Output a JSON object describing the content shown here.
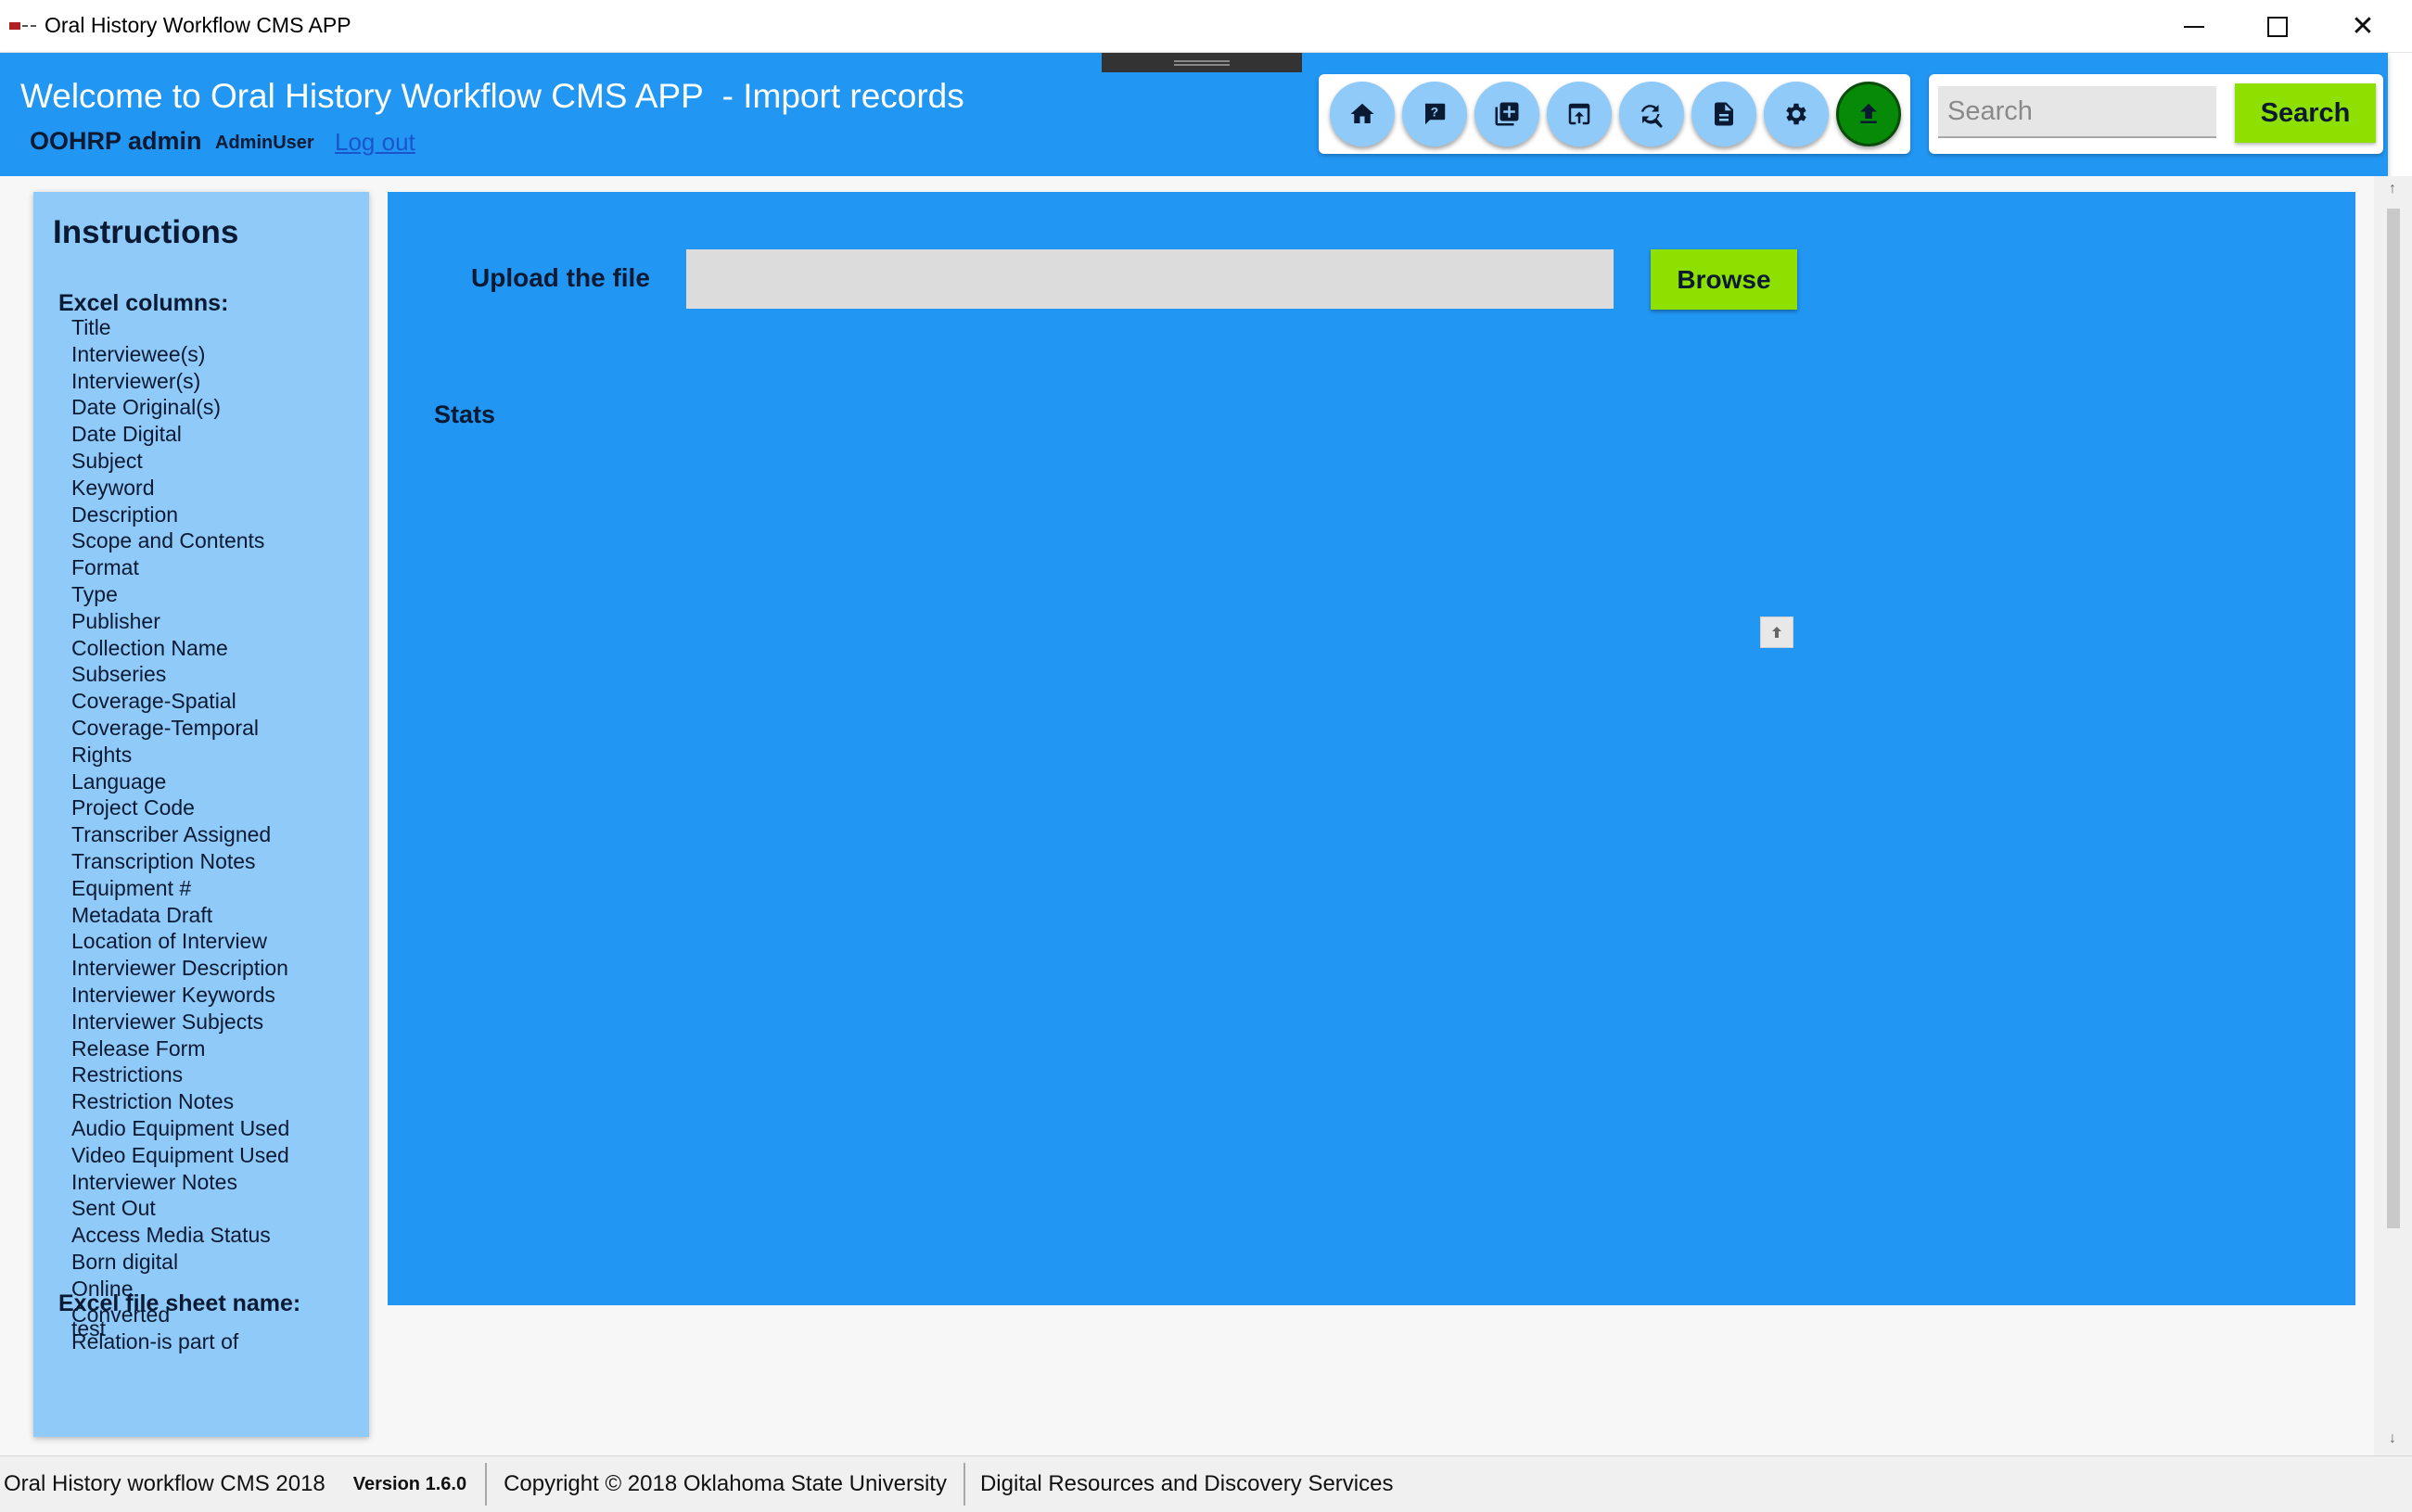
{
  "window": {
    "title": "Oral History Workflow CMS APP",
    "controls": {
      "minimize": "minimize-icon",
      "maximize": "maximize-icon",
      "close": "✕"
    }
  },
  "header": {
    "welcome": "Welcome to Oral History Workflow CMS APP  - Import records",
    "username": "OOHRP admin",
    "role": "AdminUser",
    "logout": "Log out",
    "background": "#2196f3"
  },
  "toolbar": {
    "buttons": [
      {
        "icon": "home-icon",
        "label": "Home",
        "active": false
      },
      {
        "icon": "feedback-icon",
        "label": "Help",
        "active": false
      },
      {
        "icon": "add-record-icon",
        "label": "Add record",
        "active": false
      },
      {
        "icon": "export-icon",
        "label": "Export",
        "active": false
      },
      {
        "icon": "find-replace-icon",
        "label": "Find and replace",
        "active": false
      },
      {
        "icon": "document-icon",
        "label": "Reports",
        "active": false
      },
      {
        "icon": "settings-icon",
        "label": "Settings",
        "active": false
      },
      {
        "icon": "upload-icon",
        "label": "Import records",
        "active": true
      }
    ]
  },
  "search": {
    "placeholder": "Search",
    "value": "",
    "button_label": "Search"
  },
  "instructions": {
    "title": "Instructions",
    "columns_heading": "Excel columns:",
    "columns": [
      "Title",
      "Interviewee(s)",
      "Interviewer(s)",
      "Date Original(s)",
      "Date Digital",
      "Subject",
      "Keyword",
      "Description",
      "Scope and Contents",
      "Format",
      "Type",
      "Publisher",
      "Collection Name",
      "Subseries",
      "Coverage-Spatial",
      "Coverage-Temporal",
      "Rights",
      "Language",
      "Project Code",
      "Transcriber Assigned",
      "Transcription Notes",
      "Equipment #",
      "Metadata Draft",
      "Location of Interview",
      "Interviewer Description",
      "Interviewer Keywords",
      "Interviewer Subjects",
      "Release Form",
      "Restrictions",
      "Restriction Notes",
      "Audio Equipment Used",
      "Video Equipment Used",
      "Interviewer Notes",
      "Sent Out",
      "Access Media Status",
      "Born digital",
      "Online",
      "Converted",
      "Relation-is part of"
    ],
    "sheet_heading": "Excel file sheet name:",
    "sheet_name": "test"
  },
  "import": {
    "upload_label": "Upload the file",
    "file_value": "",
    "browse_label": "Browse",
    "stats_label": "Stats"
  },
  "footer": {
    "app": "Oral History workflow CMS 2018",
    "version": "Version 1.6.0",
    "copyright": "Copyright © 2018 Oklahoma State University",
    "org": "Digital Resources and Discovery Services"
  },
  "colors": {
    "primary": "#2196f3",
    "sidebar": "#90caf9",
    "action_button": "#8ee000",
    "active_nav": "#078a07",
    "text_dark": "#0b1a33"
  }
}
